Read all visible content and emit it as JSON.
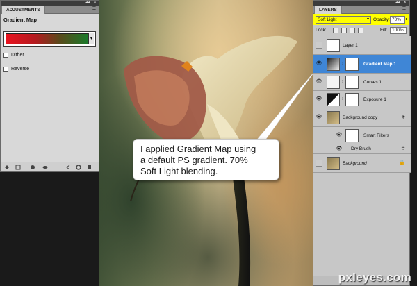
{
  "adjustments": {
    "tab": "ADJUSTMENTS",
    "title": "Gradient Map",
    "options": [
      {
        "label": "Dither",
        "checked": false
      },
      {
        "label": "Reverse",
        "checked": false
      }
    ],
    "gradient_colors": [
      "#e8131f",
      "#b51a1f",
      "#5a4a1c",
      "#1a7a2a"
    ]
  },
  "layers_panel": {
    "tab": "LAYERS",
    "blend_mode": "Soft Light",
    "opacity_label": "Opacity:",
    "opacity_value": "70%",
    "lock_label": "Lock:",
    "fill_label": "Fill:",
    "fill_value": "100%",
    "layers": [
      {
        "name": "Layer 1",
        "visible": false,
        "selected": false
      },
      {
        "name": "Gradient Map 1",
        "visible": true,
        "selected": true
      },
      {
        "name": "Curves 1",
        "visible": true,
        "selected": false
      },
      {
        "name": "Exposure 1",
        "visible": true,
        "selected": false
      },
      {
        "name": "Background copy",
        "visible": true,
        "selected": false
      },
      {
        "name": "Smart Filters",
        "visible": true,
        "selected": false
      },
      {
        "name": "Dry Brush",
        "visible": true,
        "selected": false
      },
      {
        "name": "Background",
        "visible": false,
        "selected": false
      }
    ],
    "selection_color": "#3f86d6",
    "highlight_color": "#ffff00"
  },
  "callout": {
    "lines": [
      "I applied Gradient Map using",
      "a default PS gradient. 70%",
      "Soft Light blending."
    ]
  },
  "watermark": "pxleyes.com"
}
